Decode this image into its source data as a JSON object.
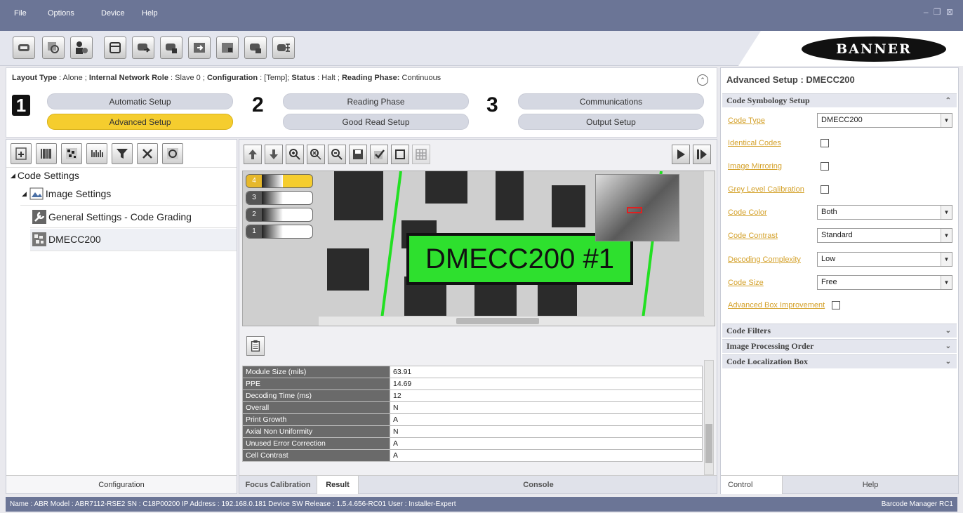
{
  "menu": {
    "items": [
      "File",
      "Options",
      "Device",
      "Help"
    ]
  },
  "window_controls": "– ❐ ⊠",
  "logo_text": "BANNER",
  "setup": {
    "layout_type_label": "Layout Type",
    "layout_type_value": "Alone",
    "network_role_label": "Internal Network Role",
    "network_role_value": "Slave 0",
    "configuration_label": "Configuration",
    "configuration_value": "[Temp]",
    "status_label": "Status",
    "status_value": "Halt",
    "reading_phase_label": "Reading Phase:",
    "reading_phase_value": "Continuous",
    "steps": [
      {
        "number": "1",
        "buttons": [
          "Automatic Setup",
          "Advanced Setup"
        ]
      },
      {
        "number": "2",
        "buttons": [
          "Reading Phase",
          "Good Read Setup"
        ]
      },
      {
        "number": "3",
        "buttons": [
          "Communications",
          "Output Setup"
        ]
      }
    ],
    "active_button": "Advanced Setup"
  },
  "tree": {
    "root": "Code Settings",
    "image_settings": "Image Settings",
    "general_settings": "General Settings - Code Grading",
    "code_node": "DMECC200"
  },
  "left_footer": "Configuration",
  "image_view": {
    "thumbnails": [
      "4",
      "3",
      "2",
      "1"
    ],
    "selected_thumbnail": "4",
    "decode_label": "DMECC200  #1"
  },
  "results": {
    "rows": [
      {
        "key": "Module Size (mils)",
        "value": "63.91"
      },
      {
        "key": "PPE",
        "value": "14.69"
      },
      {
        "key": "Decoding Time (ms)",
        "value": "12"
      },
      {
        "key": "Overall",
        "value": "N"
      },
      {
        "key": "Print Growth",
        "value": "A"
      },
      {
        "key": "Axial Non Uniformity",
        "value": "N"
      },
      {
        "key": "Unused Error Correction",
        "value": "A"
      },
      {
        "key": "Cell Contrast",
        "value": "A"
      }
    ]
  },
  "center_tabs": [
    "Focus Calibration",
    "Result",
    "Console"
  ],
  "center_active_tab": "Result",
  "right": {
    "title": "Advanced Setup : DMECC200",
    "section_code_symbology": "Code Symbology Setup",
    "props": {
      "code_type_label": "Code Type",
      "code_type_value": "DMECC200",
      "identical_codes_label": "Identical Codes",
      "identical_codes_checked": false,
      "image_mirroring_label": "Image Mirroring",
      "image_mirroring_checked": false,
      "grey_level_label": "Grey Level Calibration",
      "grey_level_checked": false,
      "code_color_label": "Code Color",
      "code_color_value": "Both",
      "code_contrast_label": "Code Contrast",
      "code_contrast_value": "Standard",
      "decoding_complexity_label": "Decoding Complexity",
      "decoding_complexity_value": "Low",
      "code_size_label": "Code Size",
      "code_size_value": "Free",
      "advanced_box_label": "Advanced Box Improvement",
      "advanced_box_checked": false
    },
    "section_code_filters": "Code Filters",
    "section_image_processing": "Image Processing Order",
    "section_localization": "Code Localization Box",
    "tabs": [
      "Control",
      "Help"
    ],
    "active_tab": "Control"
  },
  "statusbar": {
    "text": "Name : ABR  Model : ABR7112-RSE2   SN : C18P00200   IP Address :  192.168.0.181   Device SW Release : 1.5.4.656-RC01   User : Installer-Expert",
    "app": "Barcode Manager RC1"
  }
}
